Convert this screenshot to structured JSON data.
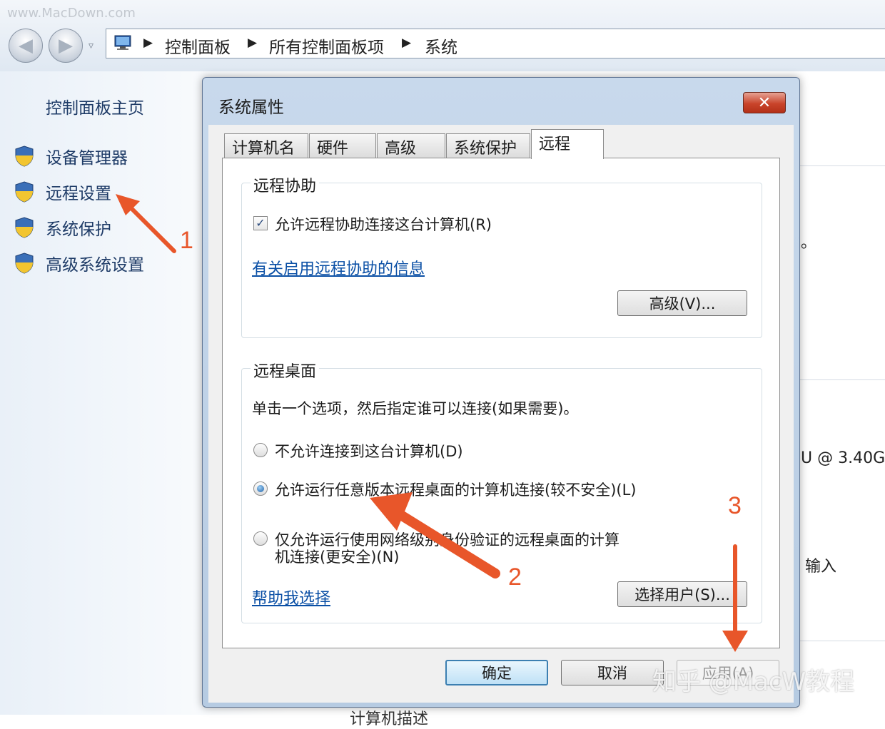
{
  "watermark_top": "www.MacDown.com",
  "breadcrumb": [
    "控制面板",
    "所有控制面板项",
    "系统"
  ],
  "left_pane": {
    "home": "控制面板主页",
    "links": [
      "设备管理器",
      "远程设置",
      "系统保护",
      "高级系统设置"
    ]
  },
  "background_right": {
    "dot": "。",
    "cpu_text": "U @ 3.40G",
    "input_text": "输入",
    "bottom_text": "计算机描述"
  },
  "dialog": {
    "title": "系统属性",
    "close": "✕",
    "tabs": [
      "计算机名",
      "硬件",
      "高级",
      "系统保护",
      "远程"
    ],
    "active_tab": "远程",
    "remote_assistance": {
      "title": "远程协助",
      "checkbox_label": "允许远程协助连接这台计算机(R)",
      "checked": true,
      "info_link": "有关启用远程协助的信息",
      "advanced_button": "高级(V)..."
    },
    "remote_desktop": {
      "title": "远程桌面",
      "instruction": "单击一个选项，然后指定谁可以连接(如果需要)。",
      "options": [
        "不允许连接到这台计算机(D)",
        "允许运行任意版本远程桌面的计算机连接(较不安全)(L)",
        "仅允许运行使用网络级别身份验证的远程桌面的计算机连接(更安全)(N)"
      ],
      "option_line1": "仅允许运行使用网络级别身份验证的远程桌面的计算",
      "option_line2": "机连接(更安全)(N)",
      "selected_option": 1,
      "help_link": "帮助我选择",
      "select_users_button": "选择用户(S)..."
    },
    "buttons": {
      "ok": "确定",
      "cancel": "取消",
      "apply": "应用(A)"
    }
  },
  "annotations": {
    "step1": "1",
    "step2": "2",
    "step3": "3"
  },
  "watermark_bottom": "知乎 @MacW教程",
  "colors": {
    "accent_arrow": "#e8562a",
    "link": "#0a4fa5",
    "close_red": "#c9442b"
  }
}
